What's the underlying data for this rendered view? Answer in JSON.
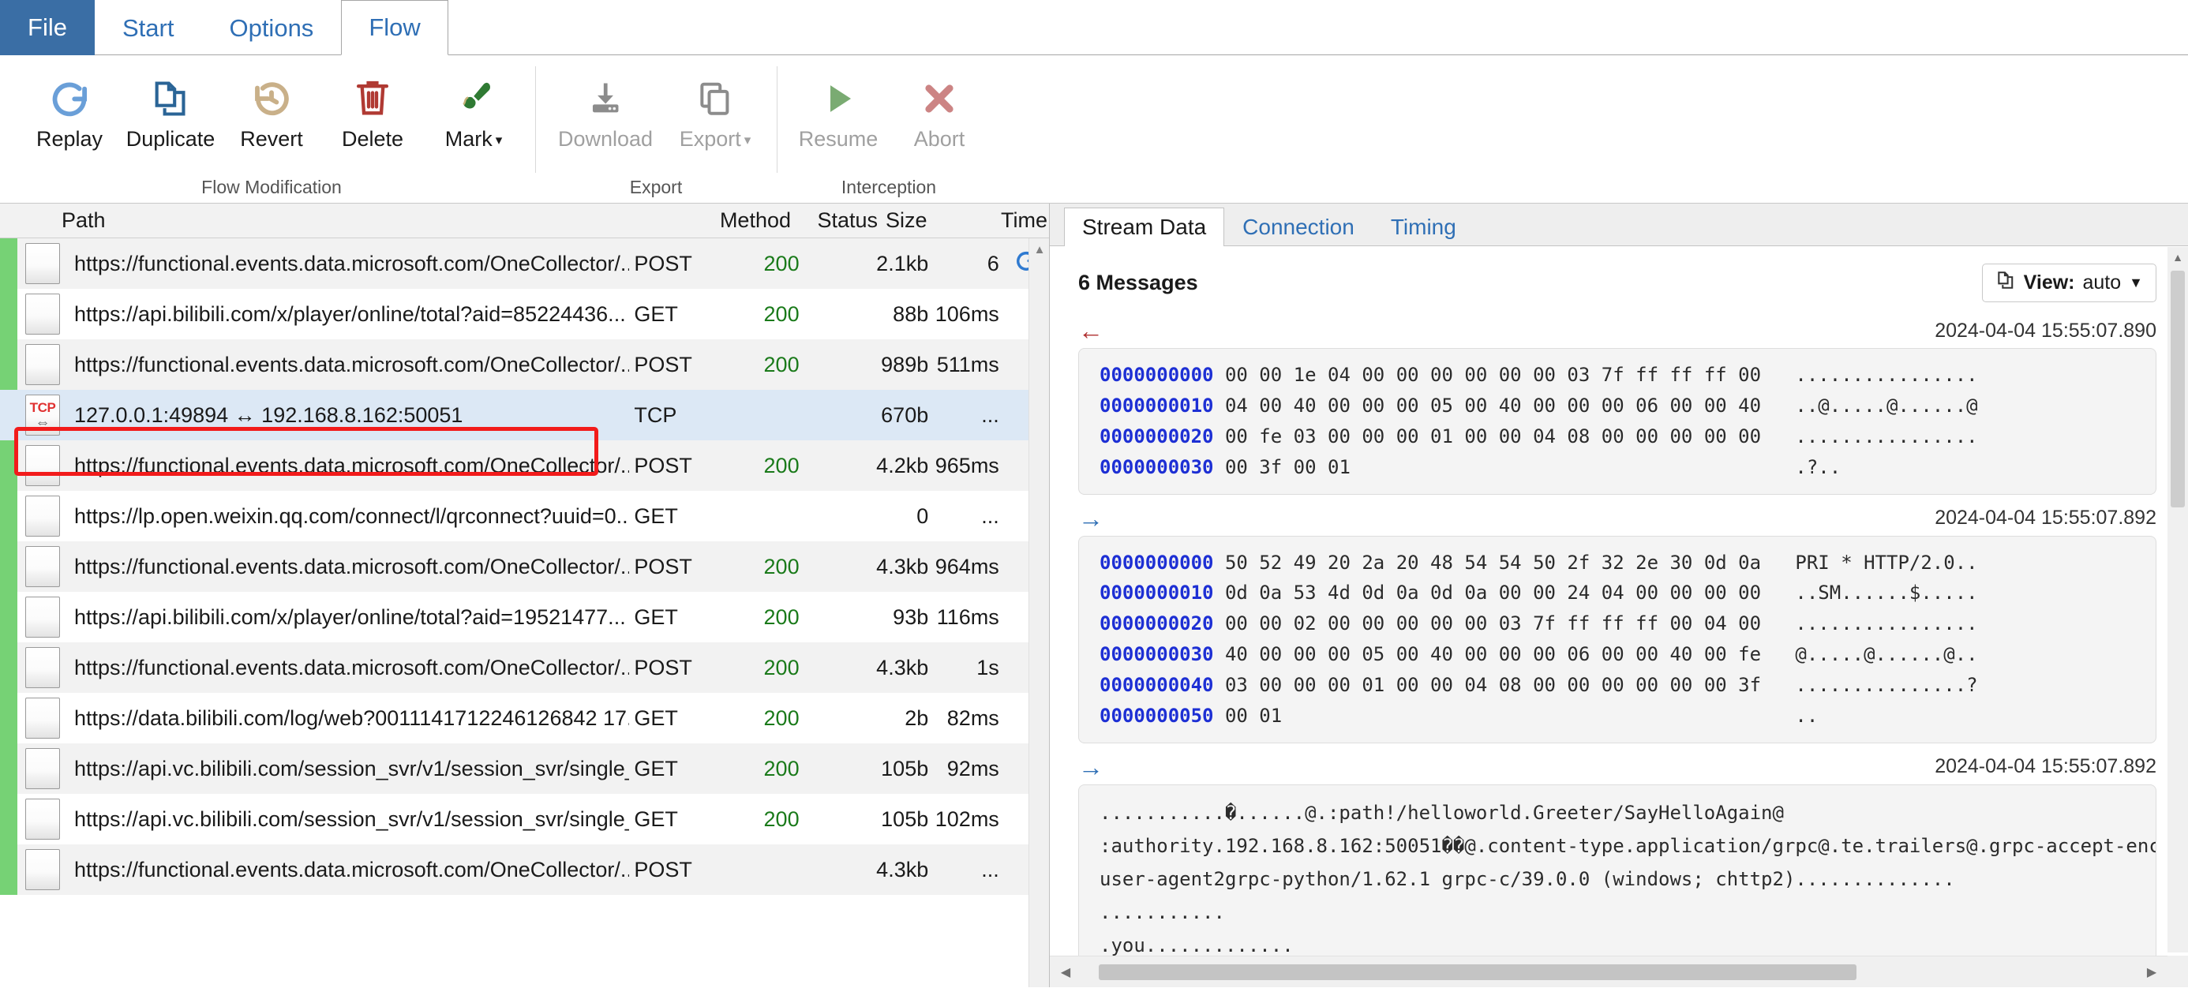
{
  "ribbon": {
    "tabs": [
      {
        "label": "File",
        "kind": "file"
      },
      {
        "label": "Start",
        "kind": "normal"
      },
      {
        "label": "Options",
        "kind": "normal"
      },
      {
        "label": "Flow",
        "kind": "active"
      }
    ],
    "groups": [
      {
        "title": "Flow Modification",
        "buttons": [
          {
            "label": "Replay",
            "icon": "replay-icon",
            "enabled": true,
            "dropdown": false
          },
          {
            "label": "Duplicate",
            "icon": "duplicate-icon",
            "enabled": true,
            "dropdown": false
          },
          {
            "label": "Revert",
            "icon": "revert-icon",
            "enabled": true,
            "dropdown": false
          },
          {
            "label": "Delete",
            "icon": "delete-icon",
            "enabled": true,
            "dropdown": false
          },
          {
            "label": "Mark",
            "icon": "mark-icon",
            "enabled": true,
            "dropdown": true
          }
        ]
      },
      {
        "title": "Export",
        "buttons": [
          {
            "label": "Download",
            "icon": "download-icon",
            "enabled": false,
            "dropdown": false
          },
          {
            "label": "Export",
            "icon": "export-icon",
            "enabled": false,
            "dropdown": true
          }
        ]
      },
      {
        "title": "Interception",
        "buttons": [
          {
            "label": "Resume",
            "icon": "resume-icon",
            "enabled": false,
            "dropdown": false
          },
          {
            "label": "Abort",
            "icon": "abort-icon",
            "enabled": false,
            "dropdown": false
          }
        ]
      }
    ]
  },
  "flow_list": {
    "columns": [
      "Path",
      "Method",
      "Status",
      "Size",
      "Time"
    ],
    "rows": [
      {
        "icon": "flow-doc-icon",
        "path": "https://functional.events.data.microsoft.com/OneCollector/...",
        "method": "POST",
        "status": "200",
        "size": "2.1kb",
        "time": "6",
        "extra": "replay-spinner-icon",
        "selected": false
      },
      {
        "icon": "flow-doc-icon",
        "path": "https://api.bilibili.com/x/player/online/total?aid=85224436...",
        "method": "GET",
        "status": "200",
        "size": "88b",
        "time": "106ms",
        "extra": "",
        "selected": false
      },
      {
        "icon": "flow-doc-icon",
        "path": "https://functional.events.data.microsoft.com/OneCollector/...",
        "method": "POST",
        "status": "200",
        "size": "989b",
        "time": "511ms",
        "extra": "",
        "selected": false
      },
      {
        "icon": "tcp-icon",
        "path": "127.0.0.1:49894 ↔ 192.168.8.162:50051",
        "method": "TCP",
        "status": "",
        "size": "670b",
        "time": "...",
        "extra": "",
        "selected": true
      },
      {
        "icon": "flow-doc-icon",
        "path": "https://functional.events.data.microsoft.com/OneCollector/...",
        "method": "POST",
        "status": "200",
        "size": "4.2kb",
        "time": "965ms",
        "extra": "",
        "selected": false
      },
      {
        "icon": "flow-doc-icon",
        "path": "https://lp.open.weixin.qq.com/connect/l/qrconnect?uuid=0...",
        "method": "GET",
        "status": "",
        "size": "0",
        "time": "...",
        "extra": "",
        "selected": false
      },
      {
        "icon": "flow-doc-icon",
        "path": "https://functional.events.data.microsoft.com/OneCollector/...",
        "method": "POST",
        "status": "200",
        "size": "4.3kb",
        "time": "964ms",
        "extra": "",
        "selected": false
      },
      {
        "icon": "flow-doc-icon",
        "path": "https://api.bilibili.com/x/player/online/total?aid=19521477...",
        "method": "GET",
        "status": "200",
        "size": "93b",
        "time": "116ms",
        "extra": "",
        "selected": false
      },
      {
        "icon": "flow-doc-icon",
        "path": "https://functional.events.data.microsoft.com/OneCollector/...",
        "method": "POST",
        "status": "200",
        "size": "4.3kb",
        "time": "1s",
        "extra": "",
        "selected": false
      },
      {
        "icon": "flow-doc-icon",
        "path": "https://data.bilibili.com/log/web?0011141712246126842 17...",
        "method": "GET",
        "status": "200",
        "size": "2b",
        "time": "82ms",
        "extra": "",
        "selected": false
      },
      {
        "icon": "flow-doc-icon",
        "path": "https://api.vc.bilibili.com/session_svr/v1/session_svr/single_...",
        "method": "GET",
        "status": "200",
        "size": "105b",
        "time": "92ms",
        "extra": "",
        "selected": false
      },
      {
        "icon": "flow-doc-icon",
        "path": "https://api.vc.bilibili.com/session_svr/v1/session_svr/single_...",
        "method": "GET",
        "status": "200",
        "size": "105b",
        "time": "102ms",
        "extra": "",
        "selected": false
      },
      {
        "icon": "flow-doc-icon",
        "path": "https://functional.events.data.microsoft.com/OneCollector/...",
        "method": "POST",
        "status": "",
        "size": "4.3kb",
        "time": "...",
        "extra": "",
        "selected": false
      }
    ]
  },
  "detail": {
    "tabs": [
      {
        "label": "Stream Data",
        "active": true
      },
      {
        "label": "Connection",
        "active": false
      },
      {
        "label": "Timing",
        "active": false
      }
    ],
    "message_count_label": "6 Messages",
    "view_button": {
      "icon": "copy-icon",
      "prefix": "View:",
      "value": "auto",
      "caret": "▼"
    },
    "messages": [
      {
        "direction": "in",
        "arrow": "←",
        "timestamp": "2024-04-04 15:55:07.890",
        "format": "hex",
        "lines": [
          {
            "offset": "0000000000",
            "hex": "00 00 1e 04 00 00 00 00 00 00 03 7f ff ff ff 00",
            "ascii": "................"
          },
          {
            "offset": "0000000010",
            "hex": "04 00 40 00 00 00 05 00 40 00 00 00 06 00 00 40",
            "ascii": "..@.....@......@"
          },
          {
            "offset": "0000000020",
            "hex": "00 fe 03 00 00 00 01 00 00 04 08 00 00 00 00 00",
            "ascii": "................"
          },
          {
            "offset": "0000000030",
            "hex": "00 3f 00 01",
            "ascii": ".?.."
          }
        ]
      },
      {
        "direction": "out",
        "arrow": "→",
        "timestamp": "2024-04-04 15:55:07.892",
        "format": "hex",
        "lines": [
          {
            "offset": "0000000000",
            "hex": "50 52 49 20 2a 20 48 54 54 50 2f 32 2e 30 0d 0a",
            "ascii": "PRI * HTTP/2.0.."
          },
          {
            "offset": "0000000010",
            "hex": "0d 0a 53 4d 0d 0a 0d 0a 00 00 24 04 00 00 00 00",
            "ascii": "..SM......$....."
          },
          {
            "offset": "0000000020",
            "hex": "00 00 02 00 00 00 00 00 03 7f ff ff ff 00 04 00",
            "ascii": "................"
          },
          {
            "offset": "0000000030",
            "hex": "40 00 00 00 05 00 40 00 00 00 06 00 00 40 00 fe",
            "ascii": "@.....@......@.."
          },
          {
            "offset": "0000000040",
            "hex": "03 00 00 00 01 00 00 04 08 00 00 00 00 00 00 3f",
            "ascii": "...............?"
          },
          {
            "offset": "0000000050",
            "hex": "00 01",
            "ascii": ".."
          }
        ]
      },
      {
        "direction": "out",
        "arrow": "→",
        "timestamp": "2024-04-04 15:55:07.892",
        "format": "text",
        "text": "...........�......@.:path!/helloworld.Greeter/SayHelloAgain@\n:authority.192.168.8.162:50051��@.content-type.application/grpc@.te.trailers@.grpc-accept-enc\nuser-agent2grpc-python/1.62.1 grpc-c/39.0.0 (windows; chttp2)..............\n...........\n.you............."
      }
    ]
  },
  "colors": {
    "accent": "#3a6ea5",
    "tab_link": "#2f6fb5",
    "status_ok": "#1a7a1a",
    "row_marker": "#76d275",
    "selection": "#dce8f5",
    "highlight_box": "#f21b1b",
    "hex_offset": "#1d2fd4"
  }
}
